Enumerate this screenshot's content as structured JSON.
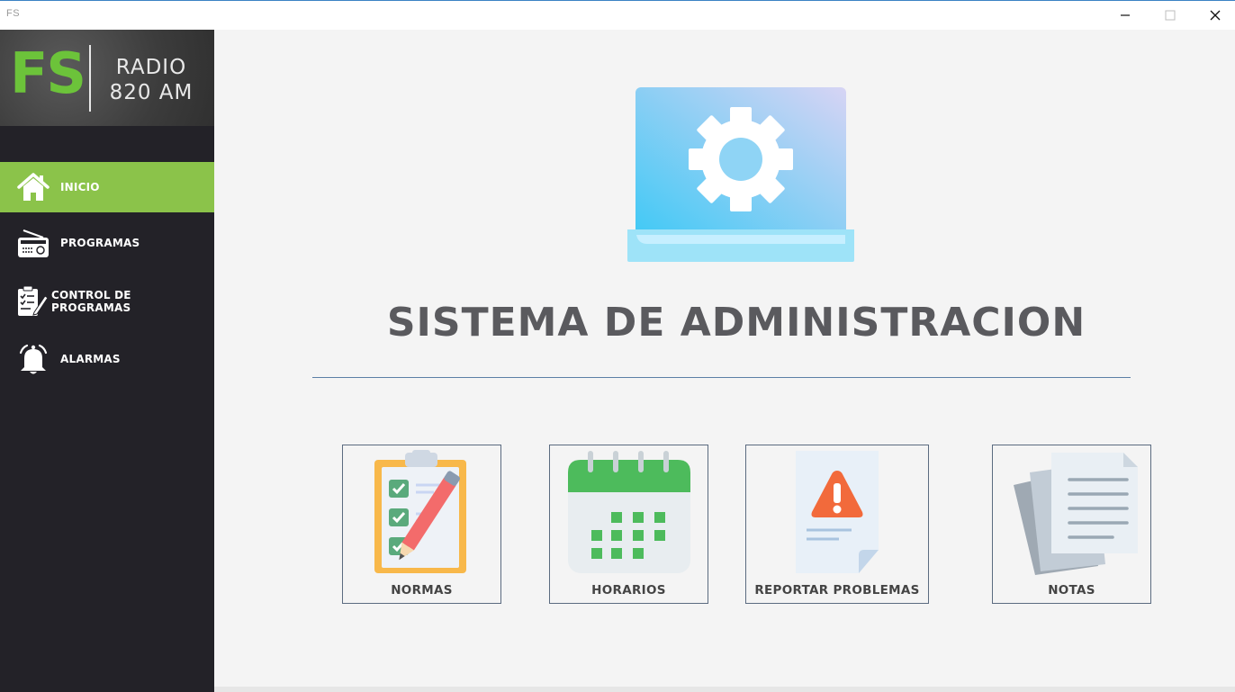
{
  "window": {
    "title": "FS"
  },
  "logo": {
    "mark": "FS",
    "line1": "RADIO",
    "line2": "820 AM"
  },
  "sidebar": {
    "items": [
      {
        "label": "INICIO",
        "icon": "home-icon",
        "active": true
      },
      {
        "label": "PROGRAMAS",
        "icon": "radio-icon",
        "active": false
      },
      {
        "label": "CONTROL DE PROGRAMAS",
        "icon": "checklist-icon",
        "active": false
      },
      {
        "label": "ALARMAS",
        "icon": "bell-icon",
        "active": false
      }
    ]
  },
  "main": {
    "hero_icon": "laptop-gear-icon",
    "title": "SISTEMA DE ADMINISTRACION",
    "cards": [
      {
        "label": "NORMAS",
        "icon": "clipboard-icon"
      },
      {
        "label": "HORARIOS",
        "icon": "calendar-icon"
      },
      {
        "label": "REPORTAR PROBLEMAS",
        "icon": "warning-document-icon"
      },
      {
        "label": "NOTAS",
        "icon": "notes-icon"
      }
    ]
  },
  "colors": {
    "sidebar_bg": "#232228",
    "active_item": "#8bc34a",
    "logo_green": "#6cc33a",
    "title_gray": "#5a5a5e"
  }
}
